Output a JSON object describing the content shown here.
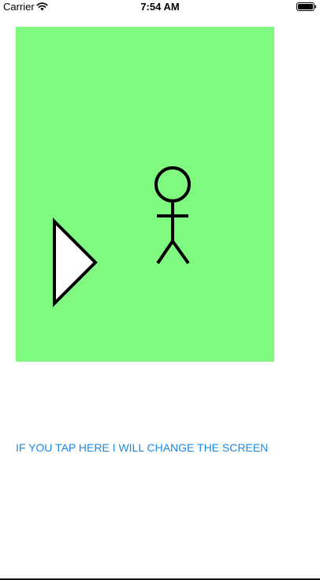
{
  "status_bar": {
    "carrier": "Carrier",
    "time": "7:54 AM",
    "wifi_icon": "wifi-icon",
    "battery_icon": "battery-icon"
  },
  "canvas": {
    "background": "#7ff97f",
    "play_icon": "play-triangle-icon",
    "figure_icon": "stick-figure-icon"
  },
  "link": {
    "label": "IF YOU TAP HERE I WILL CHANGE THE SCREEN",
    "color": "#1e88e5"
  }
}
